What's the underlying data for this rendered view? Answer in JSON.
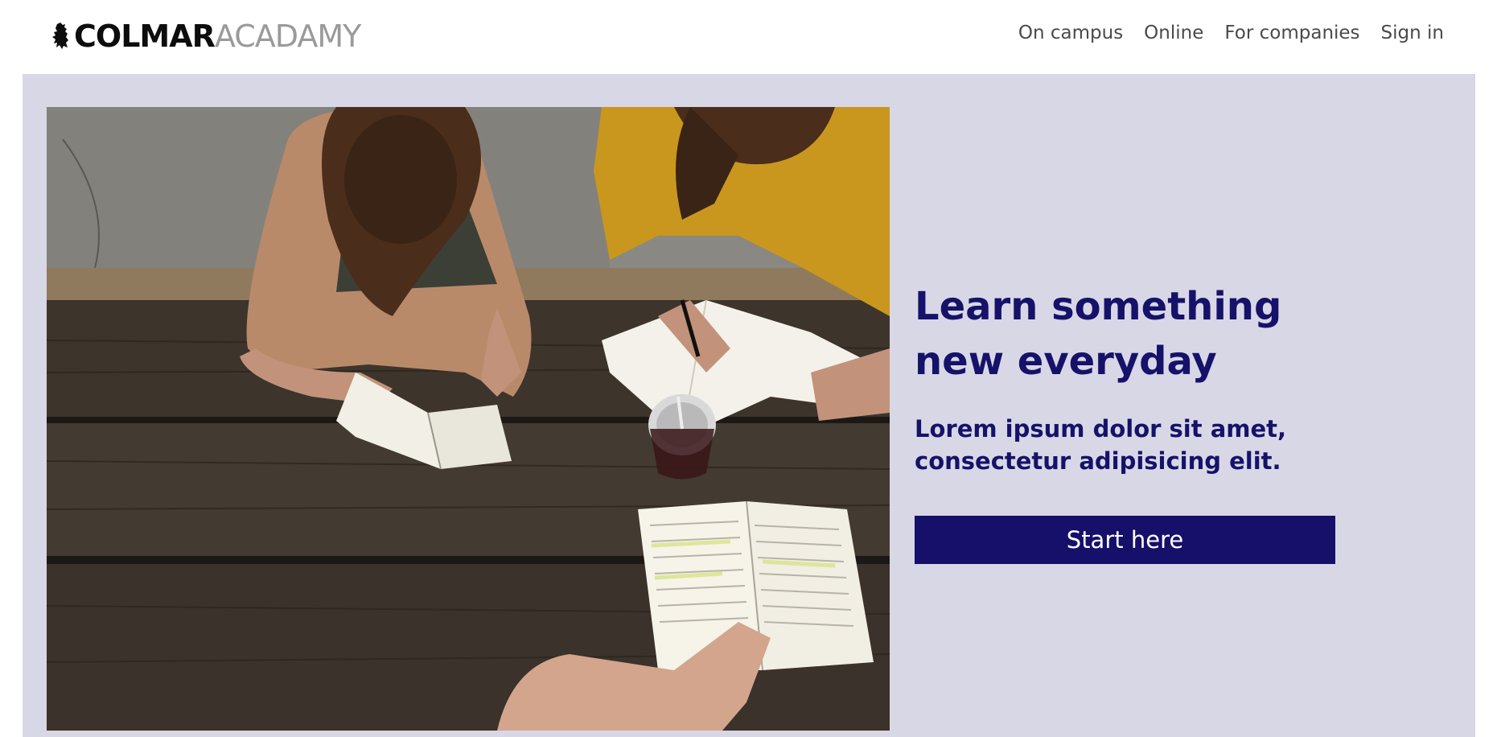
{
  "brand": {
    "name_bold": "COLMAR",
    "name_light": "ACADAMY",
    "icon": "lion-rampant-icon"
  },
  "nav": {
    "items": [
      {
        "label": "On campus"
      },
      {
        "label": "Online"
      },
      {
        "label": "For companies"
      },
      {
        "label": "Sign in"
      }
    ]
  },
  "hero": {
    "title": "Learn something new everyday",
    "subtitle": "Lorem ipsum dolor sit amet, consectetur adipisicing elit.",
    "cta_label": "Start here",
    "image": "students-studying-at-picnic-table-photo"
  },
  "colors": {
    "hero_background": "#d8d7e5",
    "accent_navy": "#16106a",
    "nav_text": "#4a4a4a",
    "logo_light": "#9a9a9a"
  }
}
